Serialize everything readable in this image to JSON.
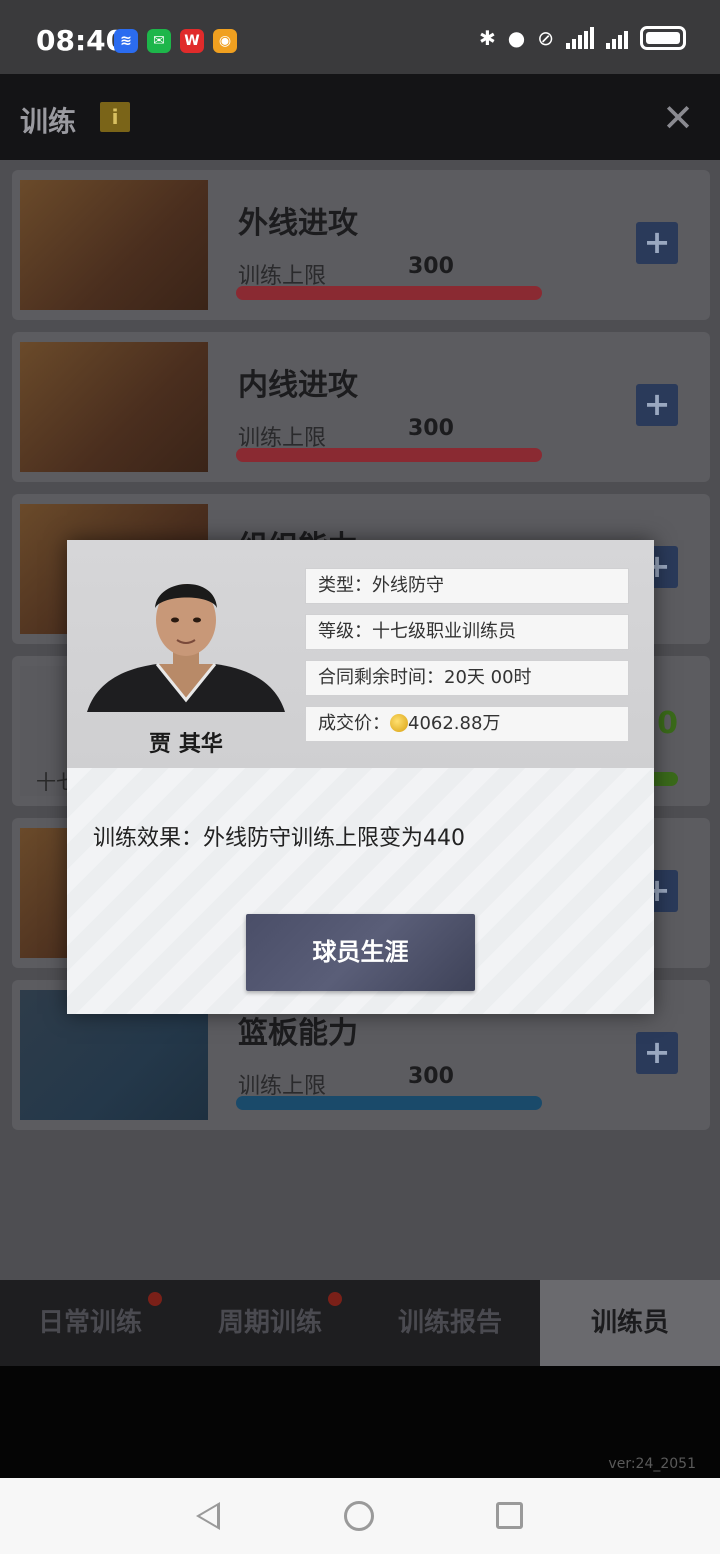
{
  "status_bar": {
    "time": "08:40",
    "apps": [
      {
        "icon": "feishu-icon",
        "color": "#2b6cf0",
        "glyph": "≋"
      },
      {
        "icon": "wechat-icon",
        "color": "#1db64a",
        "glyph": "✉"
      },
      {
        "icon": "wps-icon",
        "color": "#e02b2b",
        "glyph": "W"
      },
      {
        "icon": "weibo-icon",
        "color": "#f0a020",
        "glyph": "◉"
      }
    ]
  },
  "header": {
    "title": "训练",
    "info_glyph": "i",
    "close_glyph": "✕"
  },
  "cards": [
    {
      "name": "外线进攻",
      "limit_label": "训练上限",
      "limit_value": "300",
      "plus": "+"
    },
    {
      "name": "内线进攻",
      "limit_label": "训练上限",
      "limit_value": "300",
      "plus": "+"
    },
    {
      "name": "组织能力",
      "plus": "+"
    },
    {
      "partial_text": "十七",
      "partial_num": "0"
    },
    {
      "plus": "+"
    },
    {
      "name": "篮板能力",
      "limit_label": "训练上限",
      "limit_value": "300",
      "plus": "+"
    }
  ],
  "modal": {
    "player_name": "贾 其华",
    "type": "类型：外线防守",
    "level": "等级：十七级职业训练员",
    "contract": "合同剩余时间：20天 00时",
    "price_label": "成交价：",
    "price_value": "4062.88万",
    "effect": "训练效果：外线防守训练上限变为440",
    "career_button": "球员生涯"
  },
  "tabs": [
    {
      "label": "日常训练",
      "dot": true
    },
    {
      "label": "周期训练",
      "dot": true
    },
    {
      "label": "训练报告",
      "dot": false
    },
    {
      "label": "训练员",
      "dot": false,
      "active": true
    }
  ],
  "version": "ver:24_2051"
}
